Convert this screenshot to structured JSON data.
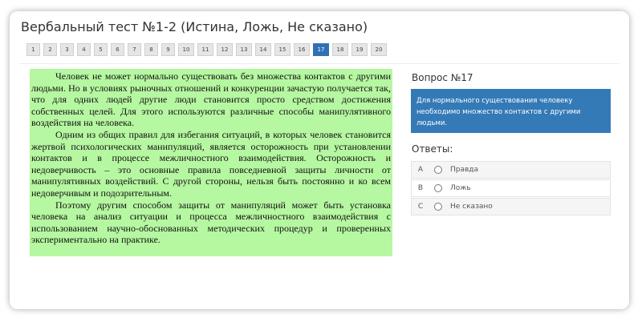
{
  "title": "Вербальный тест №1-2 (Истина, Ложь, Не сказано)",
  "pages": [
    "1",
    "2",
    "3",
    "4",
    "5",
    "6",
    "7",
    "8",
    "9",
    "10",
    "11",
    "12",
    "13",
    "14",
    "15",
    "16",
    "17",
    "18",
    "19",
    "20"
  ],
  "active_page": "17",
  "passage": [
    "Человек не может нормально существовать без множества контактов с другими людьми. Но в условиях рыночных отношений и конкуренции зачастую получается так, что для одних людей другие люди становится просто средством достижения собственных целей. Для этого используются различные способы манипулятивного воздействия на человека.",
    "Одним из общих правил для избегания ситуаций, в которых человек становится жертвой психологических манипуляций, является осторожность при установлении контактов и в процессе межличностного взаимодействия. Осторожность и недоверчивость – это основные правила повседневной защиты личности от манипулятивных воздействий. С другой стороны, нельзя быть постоянно и ко всем недоверчивым и подозрительным.",
    "Поэтому другим способом защиты от манипуляций может быть установка человека на анализ ситуации и процесса межличностного взаимодействия с использованием научно-обоснованных методических процедур и проверенных экспериментально на практике."
  ],
  "question": {
    "heading": "Вопрос №17",
    "text": "Для нормального существования человеку необходимо множество контактов с другими людьми."
  },
  "answers_heading": "Ответы:",
  "answers": [
    {
      "letter": "A",
      "label": "Правда"
    },
    {
      "letter": "B",
      "label": "Ложь"
    },
    {
      "letter": "C",
      "label": "Не сказано"
    }
  ],
  "colors": {
    "accent": "#337ab7",
    "passage_bg": "#b6f7a1"
  }
}
